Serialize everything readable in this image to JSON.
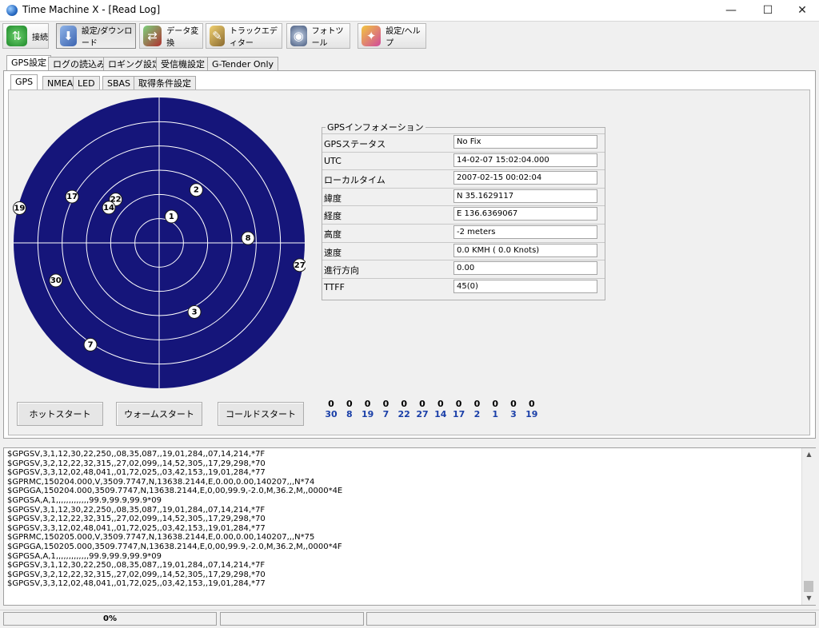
{
  "window": {
    "title": "Time Machine X - [Read Log]",
    "minimize": "—",
    "maximize": "☐",
    "close": "✕"
  },
  "toolbar": {
    "connect": "接続",
    "settings_download": "設定/ダウンロード",
    "data_convert": "データ変換",
    "track_editor": "トラックエディター",
    "photo_tool": "フォトツール",
    "settings_help": "設定/ヘルプ"
  },
  "main_tabs": [
    "GPS設定",
    "ログの読込み",
    "ロギング設定",
    "受信機設定",
    "G-Tender Only"
  ],
  "sub_tabs": [
    "GPS",
    "NMEA",
    "LED",
    "SBAS",
    "取得条件設定"
  ],
  "gps_info": {
    "title": "GPSインフォメーション",
    "rows": [
      {
        "label": "GPSステータス",
        "value": "No Fix"
      },
      {
        "label": "UTC",
        "value": "14-02-07 15:02:04.000"
      },
      {
        "label": "ローカルタイム",
        "value": "2007-02-15 00:02:04"
      },
      {
        "label": "緯度",
        "value": "N 35.1629117"
      },
      {
        "label": "経度",
        "value": "E 136.6369067"
      },
      {
        "label": "高度",
        "value": "-2 meters"
      },
      {
        "label": "速度",
        "value": "0.0 KMH ( 0.0 Knots)"
      },
      {
        "label": "進行方向",
        "value": "0.00"
      },
      {
        "label": "TTFF",
        "value": "45(0)"
      }
    ]
  },
  "buttons": {
    "hot_start": "ホットスタート",
    "warm_start": "ウォームスタート",
    "cold_start": "コールドスタート"
  },
  "satellites": [
    {
      "prn": "22",
      "elevation": 52,
      "azimuth": 315
    },
    {
      "prn": "17",
      "elevation": 29,
      "azimuth": 298
    },
    {
      "prn": "14",
      "elevation": 52,
      "azimuth": 305
    },
    {
      "prn": "2",
      "elevation": 50,
      "azimuth": 35
    },
    {
      "prn": "1",
      "elevation": 72,
      "azimuth": 25
    },
    {
      "prn": "8",
      "elevation": 35,
      "azimuth": 87
    },
    {
      "prn": "19",
      "elevation": 1,
      "azimuth": 284
    },
    {
      "prn": "27",
      "elevation": 2,
      "azimuth": 99
    },
    {
      "prn": "30",
      "elevation": 22,
      "azimuth": 250
    },
    {
      "prn": "3",
      "elevation": 42,
      "azimuth": 153
    },
    {
      "prn": "7",
      "elevation": 14,
      "azimuth": 214
    }
  ],
  "snr_table": [
    {
      "snr": "0",
      "prn": "30"
    },
    {
      "snr": "0",
      "prn": "8"
    },
    {
      "snr": "0",
      "prn": "19"
    },
    {
      "snr": "0",
      "prn": "7"
    },
    {
      "snr": "0",
      "prn": "22"
    },
    {
      "snr": "0",
      "prn": "27"
    },
    {
      "snr": "0",
      "prn": "14"
    },
    {
      "snr": "0",
      "prn": "17"
    },
    {
      "snr": "0",
      "prn": "2"
    },
    {
      "snr": "0",
      "prn": "1"
    },
    {
      "snr": "0",
      "prn": "3"
    },
    {
      "snr": "0",
      "prn": "19"
    }
  ],
  "log_lines": [
    "$GPGSV,3,1,12,30,22,250,,08,35,087,,19,01,284,,07,14,214,*7F",
    "$GPGSV,3,2,12,22,32,315,,27,02,099,,14,52,305,,17,29,298,*70",
    "$GPGSV,3,3,12,02,48,041,,01,72,025,,03,42,153,,19,01,284,*77",
    "$GPRMC,150204.000,V,3509.7747,N,13638.2144,E,0.00,0.00,140207,,,N*74",
    "$GPGGA,150204.000,3509.7747,N,13638.2144,E,0,00,99.9,-2.0,M,36.2,M,,0000*4E",
    "$GPGSA,A,1,,,,,,,,,,,,,99.9,99.9,99.9*09",
    "$GPGSV,3,1,12,30,22,250,,08,35,087,,19,01,284,,07,14,214,*7F",
    "$GPGSV,3,2,12,22,32,315,,27,02,099,,14,52,305,,17,29,298,*70",
    "$GPGSV,3,3,12,02,48,041,,01,72,025,,03,42,153,,19,01,284,*77",
    "$GPRMC,150205.000,V,3509.7747,N,13638.2144,E,0.00,0.00,140207,,,N*75",
    "$GPGGA,150205.000,3509.7747,N,13638.2144,E,0,00,99.9,-2.0,M,36.2,M,,0000*4F",
    "$GPGSA,A,1,,,,,,,,,,,,,99.9,99.9,99.9*09",
    "$GPGSV,3,1,12,30,22,250,,08,35,087,,19,01,284,,07,14,214,*7F",
    "$GPGSV,3,2,12,22,32,315,,27,02,099,,14,52,305,,17,29,298,*70",
    "$GPGSV,3,3,12,02,48,041,,01,72,025,,03,42,153,,19,01,284,*77"
  ],
  "status": {
    "progress_text": "0%",
    "progress": 0
  },
  "colors": {
    "sky_plot_background": "#15157a",
    "sky_plot_lines": "#ffffff"
  }
}
